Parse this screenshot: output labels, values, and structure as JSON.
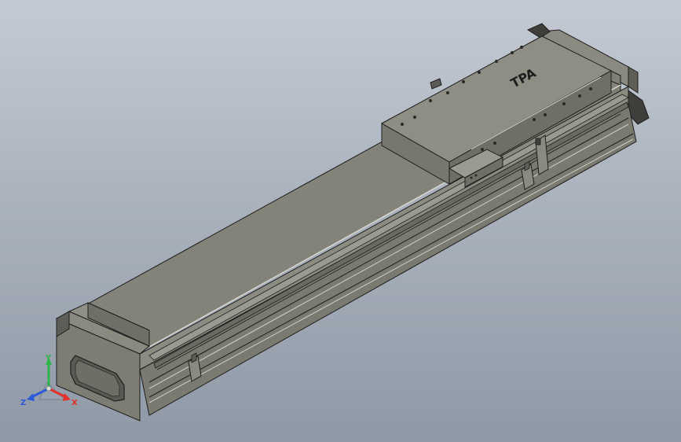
{
  "viewport": {
    "background_top": "#c3cad3",
    "background_bottom": "#8f99a6"
  },
  "model": {
    "part": "linear-actuator-module",
    "body_color": "#85857a",
    "top_color": "#7d7d72",
    "side_color": "#6d6d64",
    "edge_color": "#1e1e1e",
    "highlight_color": "#d8d8d0",
    "logo_text": "TPA"
  },
  "triad": {
    "x_label": "X",
    "y_label": "Y",
    "z_label": "Z",
    "x_color": "#e0312a",
    "y_color": "#2fb34a",
    "z_color": "#2c5ad9"
  }
}
